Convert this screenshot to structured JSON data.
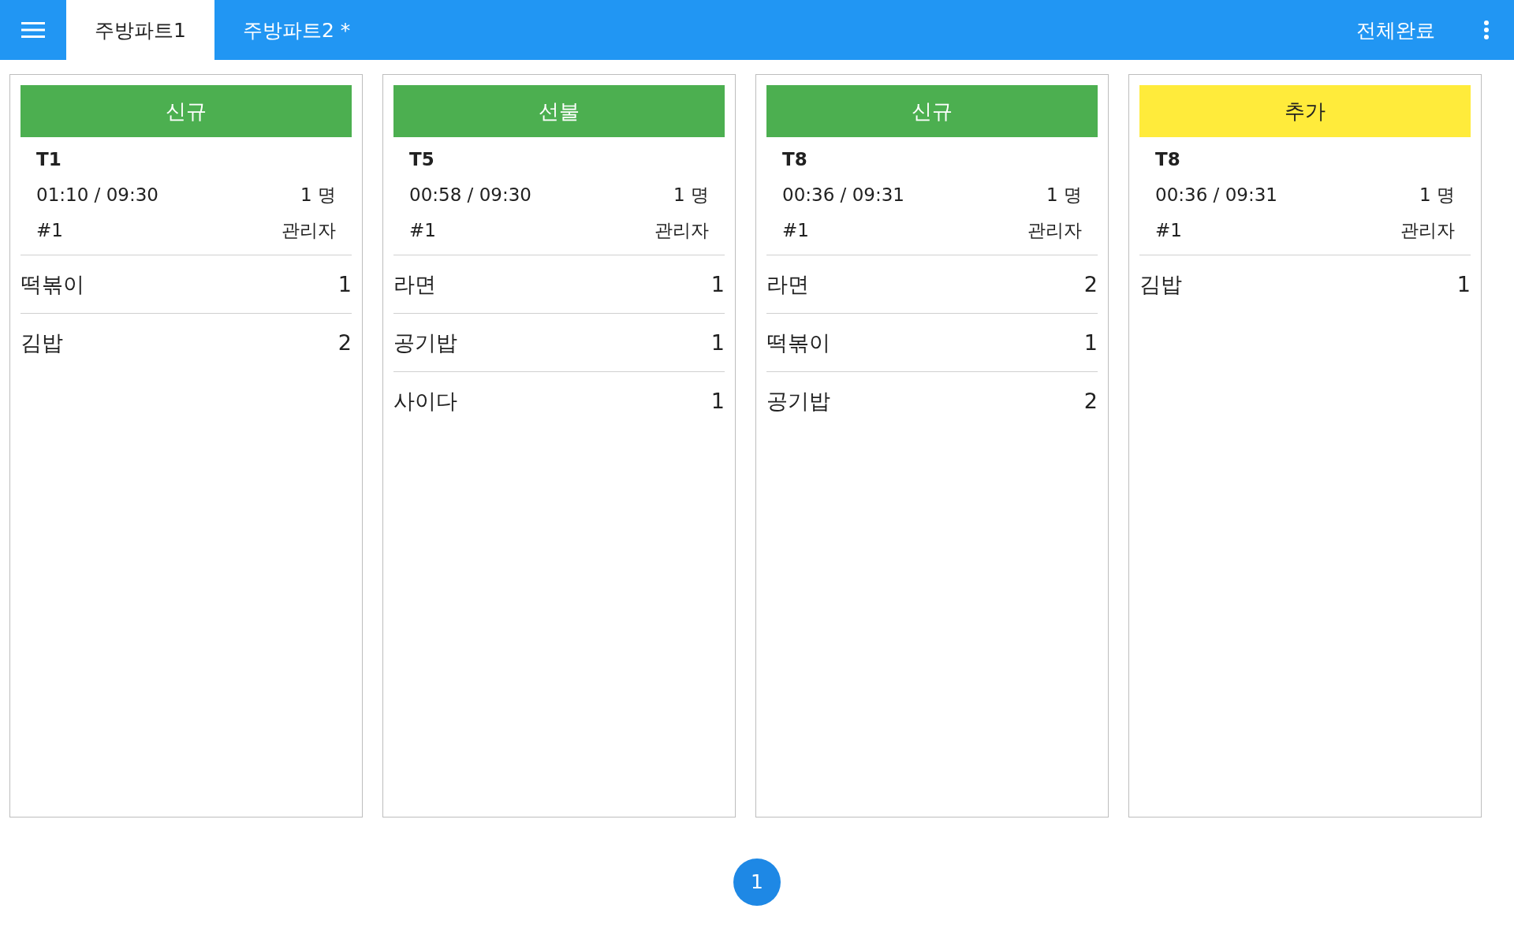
{
  "top_bar": {
    "tabs": [
      {
        "label": "주방파트1",
        "selected": true
      },
      {
        "label": "주방파트2 *",
        "selected": false
      }
    ],
    "complete_all_button": "전체완료"
  },
  "orders": [
    {
      "status": "신규",
      "kind": "new",
      "color": "#4caf50",
      "table": "T1",
      "time": "01:10 / 09:30",
      "guests": "1 명",
      "number": "#1",
      "staff": "관리자",
      "items": [
        {
          "name": "떡볶이",
          "qty": "1"
        },
        {
          "name": "김밥",
          "qty": "2"
        }
      ]
    },
    {
      "status": "선불",
      "kind": "prepaid",
      "color": "#4caf50",
      "table": "T5",
      "time": "00:58 / 09:30",
      "guests": "1 명",
      "number": "#1",
      "staff": "관리자",
      "items": [
        {
          "name": "라면",
          "qty": "1"
        },
        {
          "name": "공기밥",
          "qty": "1"
        },
        {
          "name": "사이다",
          "qty": "1"
        }
      ]
    },
    {
      "status": "신규",
      "kind": "new",
      "color": "#4caf50",
      "table": "T8",
      "time": "00:36 / 09:31",
      "guests": "1 명",
      "number": "#1",
      "staff": "관리자",
      "items": [
        {
          "name": "라면",
          "qty": "2"
        },
        {
          "name": "떡볶이",
          "qty": "1"
        },
        {
          "name": "공기밥",
          "qty": "2"
        }
      ]
    },
    {
      "status": "추가",
      "kind": "added",
      "color": "#ffeb3b",
      "table": "T8",
      "time": "00:36 / 09:31",
      "guests": "1 명",
      "number": "#1",
      "staff": "관리자",
      "items": [
        {
          "name": "김밥",
          "qty": "1"
        }
      ]
    }
  ],
  "pagination": [
    {
      "label": "1",
      "selected": true
    }
  ]
}
